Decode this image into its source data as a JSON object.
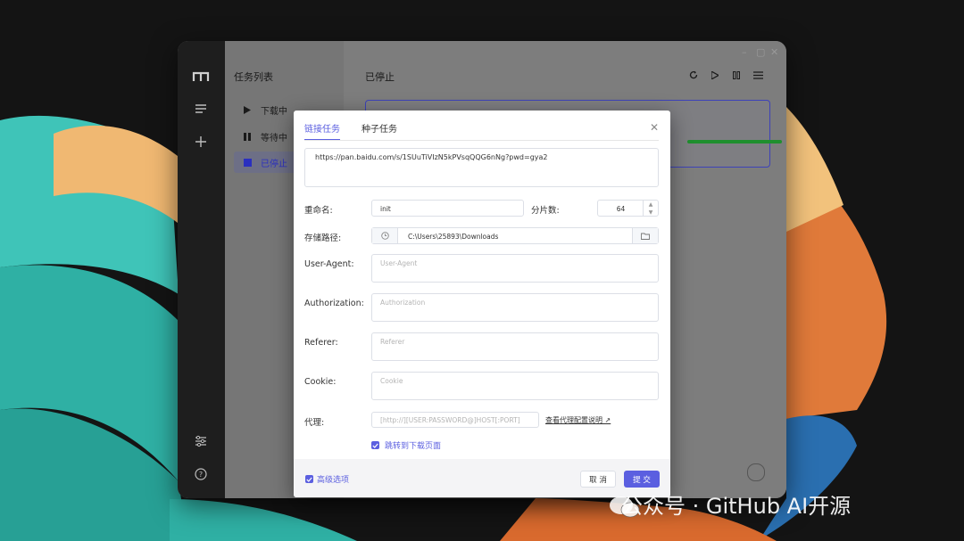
{
  "app": {
    "logo_icon": "m-logo-icon",
    "sidebar_icons": [
      "menu-icon",
      "plus-icon",
      "sliders-icon",
      "help-icon"
    ]
  },
  "task_panel": {
    "title": "任务列表",
    "items": [
      {
        "label": "下载中",
        "icon": "play-icon"
      },
      {
        "label": "等待中",
        "icon": "pause-icon"
      },
      {
        "label": "已停止",
        "icon": "stop-icon"
      }
    ]
  },
  "main": {
    "title": "已停止",
    "toolbar_icons": [
      "refresh-icon",
      "play-icon",
      "pause-icon",
      "list-icon"
    ]
  },
  "dialog": {
    "tabs": [
      {
        "label": "链接任务",
        "active": true
      },
      {
        "label": "种子任务",
        "active": false
      }
    ],
    "url_text": "https://pan.baidu.com/s/1SUuTiVIzN5kPVsqQQG6nNg?pwd=gya2",
    "rename_label": "重命名:",
    "rename_value": "init",
    "split_label": "分片数:",
    "split_value": "64",
    "path_label": "存储路径:",
    "path_value": "C:\\Users\\25893\\Downloads",
    "user_agent_label": "User-Agent:",
    "user_agent_placeholder": "User-Agent",
    "authorization_label": "Authorization:",
    "authorization_placeholder": "Authorization",
    "referer_label": "Referer:",
    "referer_placeholder": "Referer",
    "cookie_label": "Cookie:",
    "cookie_placeholder": "Cookie",
    "proxy_label": "代理:",
    "proxy_placeholder": "[http://][USER:PASSWORD@]HOST[:PORT]",
    "proxy_link": "查看代理配置说明",
    "jump_label": "跳转到下载页面",
    "advanced_label": "高级选项",
    "cancel_label": "取 消",
    "submit_label": "提 交"
  },
  "watermark": "公众号 · GitHub AI开源",
  "colors": {
    "accent": "#5b5fe0",
    "progress": "#1f8f2e"
  }
}
